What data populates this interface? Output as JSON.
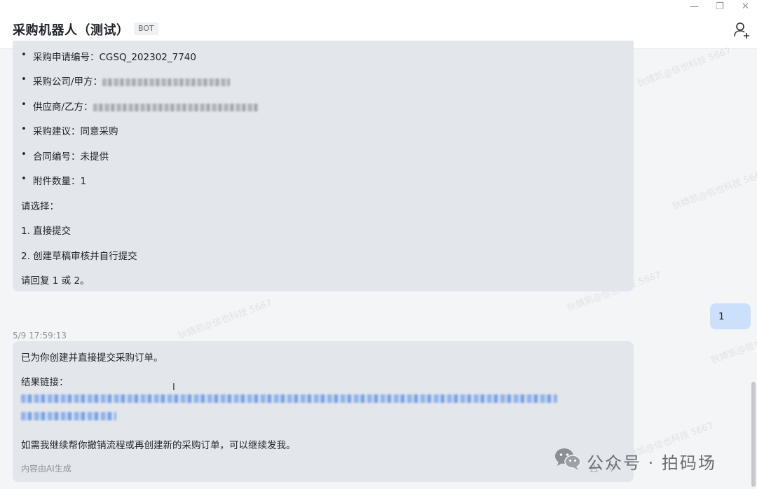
{
  "header": {
    "title": "采购机器人（测试）",
    "badge": "BOT"
  },
  "window_controls": {
    "minimize_glyph": "—",
    "restore_glyph": "❐",
    "close_glyph": "✕"
  },
  "message1": {
    "items": [
      {
        "label": "采购申请编号：",
        "value": "CGSQ_202302_7740"
      },
      {
        "label": "采购公司/甲方：",
        "value": ""
      },
      {
        "label": "供应商/乙方：",
        "value": ""
      },
      {
        "label": "采购建议：",
        "value": "同意采购"
      },
      {
        "label": "合同编号：",
        "value": "未提供"
      },
      {
        "label": "附件数量：",
        "value": "1"
      }
    ],
    "prompt": "请选择：",
    "options": [
      "1. 直接提交",
      "2. 创建草稿审核并自行提交"
    ],
    "reply_hint": "请回复 1 或 2。"
  },
  "user_message": {
    "text": "1"
  },
  "message2": {
    "timestamp": "5/9 17:59:13",
    "line1": "已为你创建并直接提交采购订单。",
    "result_label": "结果链接：",
    "line3": "如需我继续帮你撤销流程或再创建新的采购订单，可以继续发我。",
    "ai_note": "内容由AI生成"
  },
  "watermark": {
    "text": "狄婧凯@信也科技 5667"
  },
  "overlay": {
    "text": "公众号 · 拍码场",
    "icon": "wechat-icon"
  },
  "colors": {
    "bot_bubble": "#e3e6ea",
    "user_bubble": "#cce0fc",
    "link": "#3370ff"
  }
}
